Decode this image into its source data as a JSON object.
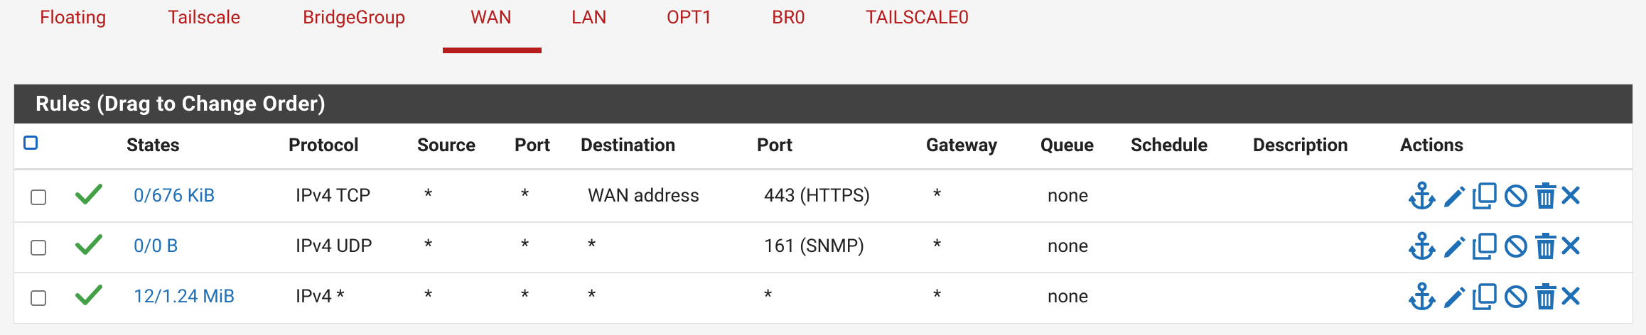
{
  "tabs": [
    {
      "label": "Floating"
    },
    {
      "label": "Tailscale"
    },
    {
      "label": "BridgeGroup"
    },
    {
      "label": "WAN"
    },
    {
      "label": "LAN"
    },
    {
      "label": "OPT1"
    },
    {
      "label": "BR0"
    },
    {
      "label": "TAILSCALE0"
    }
  ],
  "active_tab": "WAN",
  "panel": {
    "title": "Rules (Drag to Change Order)"
  },
  "columns": {
    "states": "States",
    "protocol": "Protocol",
    "source": "Source",
    "port": "Port",
    "destination": "Destination",
    "dest_port": "Port",
    "gateway": "Gateway",
    "queue": "Queue",
    "schedule": "Schedule",
    "description": "Description",
    "actions": "Actions"
  },
  "rows": [
    {
      "states": "0/676 KiB",
      "protocol": "IPv4 TCP",
      "source": "*",
      "port": "*",
      "destination": "WAN address",
      "dest_port": "443 (HTTPS)",
      "gateway": "*",
      "queue": "none",
      "schedule": "",
      "description": ""
    },
    {
      "states": "0/0 B",
      "protocol": "IPv4 UDP",
      "source": "*",
      "port": "*",
      "destination": "*",
      "dest_port": "161 (SNMP)",
      "gateway": "*",
      "queue": "none",
      "schedule": "",
      "description": ""
    },
    {
      "states": "12/1.24 MiB",
      "protocol": "IPv4 *",
      "source": "*",
      "port": "*",
      "destination": "*",
      "dest_port": "*",
      "gateway": "*",
      "queue": "none",
      "schedule": "",
      "description": ""
    }
  ],
  "icons": {
    "enabled": "check-icon",
    "anchor": "anchor-icon",
    "edit": "pencil-icon",
    "copy": "copy-icon",
    "disable": "ban-icon",
    "delete": "trash-icon",
    "remove": "times-icon"
  },
  "colors": {
    "accent": "#b71c1c",
    "link": "#1e6fb6",
    "header_bar": "#424242",
    "enabled": "#43a047",
    "action": "#1e6fb6"
  }
}
